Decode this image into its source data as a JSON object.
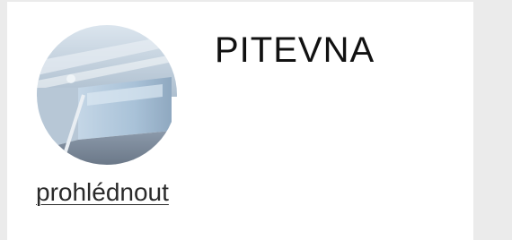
{
  "card": {
    "title": "PITEVNA",
    "link_label": "prohlédnout",
    "thumbnail": {
      "icon": "room-photo-thumbnail",
      "colors": {
        "wall": "#9eb8d0",
        "wall_light": "#cfe0ee",
        "floor": "#7d8c9e",
        "ceiling": "#c9d6e2"
      }
    }
  },
  "colors": {
    "page_background": "#ebebeb",
    "card_background": "#ffffff",
    "title_text": "#111111",
    "link_text": "#2a2a2a"
  }
}
